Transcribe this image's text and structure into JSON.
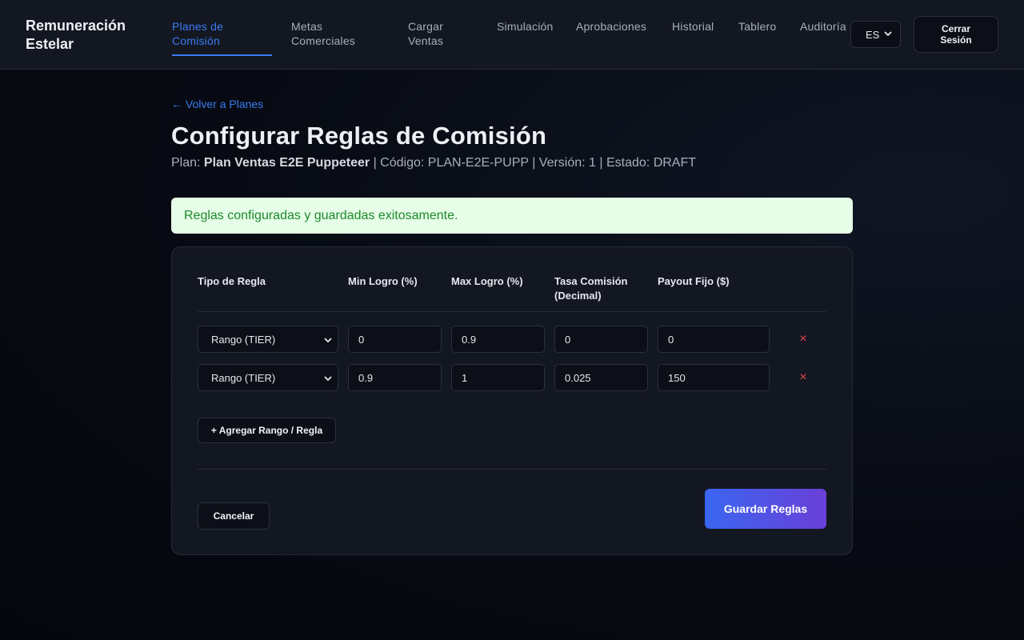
{
  "header": {
    "brand": "Remuneración Estelar",
    "nav": [
      {
        "label": "Planes de Comisión",
        "active": true
      },
      {
        "label": "Metas Comerciales",
        "active": false
      },
      {
        "label": "Cargar Ventas",
        "active": false
      },
      {
        "label": "Simulación",
        "active": false
      },
      {
        "label": "Aprobaciones",
        "active": false
      },
      {
        "label": "Historial",
        "active": false
      },
      {
        "label": "Tablero",
        "active": false
      },
      {
        "label": "Auditoría",
        "active": false
      }
    ],
    "language": "ES",
    "logout_label": "Cerrar Sesión",
    "accent_color": "#3b7bf0"
  },
  "main": {
    "back_link": "← Volver a Planes",
    "title": "Configurar Reglas de Comisión",
    "plan_prefix": "Plan: ",
    "plan_name": "Plan Ventas E2E Puppeteer",
    "plan_meta": " | Código: PLAN-E2E-PUPP | Versión: 1 | Estado: DRAFT",
    "success_message": "Reglas configuradas y guardadas exitosamente.",
    "table": {
      "headers": [
        "Tipo de Regla",
        "Min Logro (%)",
        "Max Logro (%)",
        "Tasa Comisión (Decimal)",
        "Payout Fijo ($)"
      ],
      "rows": [
        {
          "type": "Rango (TIER)",
          "min": "0",
          "max": "0.9",
          "rate": "0",
          "payout": "0"
        },
        {
          "type": "Rango (TIER)",
          "min": "0.9",
          "max": "1",
          "rate": "0.025",
          "payout": "150"
        }
      ],
      "remove_symbol": "×"
    },
    "add_button": "+ Agregar Rango / Regla",
    "cancel_button": "Cancelar",
    "save_button": "Guardar Reglas",
    "icons": {
      "select": "chevron-down-icon",
      "remove": "close-icon"
    }
  }
}
